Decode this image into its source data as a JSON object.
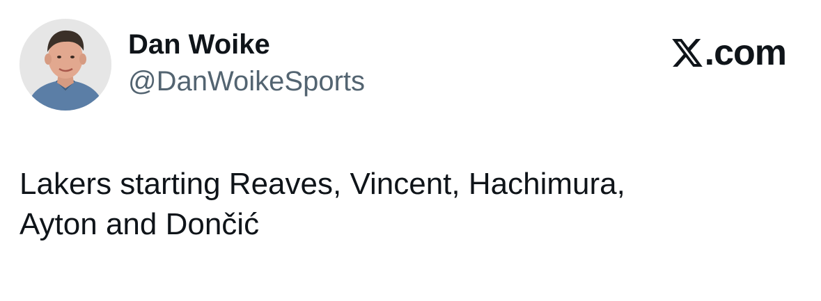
{
  "tweet": {
    "author": {
      "display_name": "Dan Woike",
      "handle": "@DanWoikeSports"
    },
    "brand": {
      "text": ".com",
      "icon": "x-logo-icon"
    },
    "text_lines": [
      "Lakers starting Reaves, Vincent, Hachimura,",
      "Ayton and Dončić"
    ]
  },
  "colors": {
    "text_primary": "#0f1419",
    "text_secondary": "#536471",
    "background": "#ffffff"
  }
}
